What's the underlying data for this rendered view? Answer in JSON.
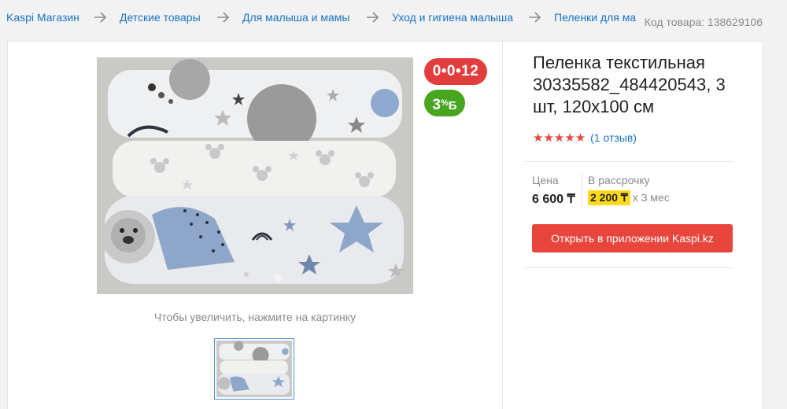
{
  "breadcrumbs": [
    {
      "label": "Kaspi Магазин"
    },
    {
      "label": "Детские товары"
    },
    {
      "label": "Для малыша и мамы"
    },
    {
      "label": "Уход и гигиена малыша"
    },
    {
      "label": "Пеленки для малыша"
    }
  ],
  "product_code": "Код товара: 138629106",
  "product": {
    "title": "Пеленка текстильная 30335582_484420543, 3 шт, 120x100 см",
    "rating_stars": "★★★★★",
    "reviews": "(1 отзыв)",
    "price_label": "Цена",
    "price": "6 600 ₸",
    "installment_label": "В рассрочку",
    "installment_amount": "2 200 ₸",
    "installment_term": "x 3 мес",
    "open_app_button": "Открыть в приложении Kaspi.kz"
  },
  "badges": {
    "installment_text": "0•0•12",
    "bonus_percent": "3",
    "bonus_sign": "%",
    "bonus_letter": "Б"
  },
  "gallery": {
    "zoom_hint": "Чтобы увеличить, нажмите на картинку"
  },
  "colors": {
    "link": "#1a73c6",
    "accent_red": "#e8453c",
    "bonus_green": "#47a51f",
    "installment_yellow": "#ffd91c"
  },
  "icons": [
    "arrow-right-icon",
    "star-icon"
  ]
}
